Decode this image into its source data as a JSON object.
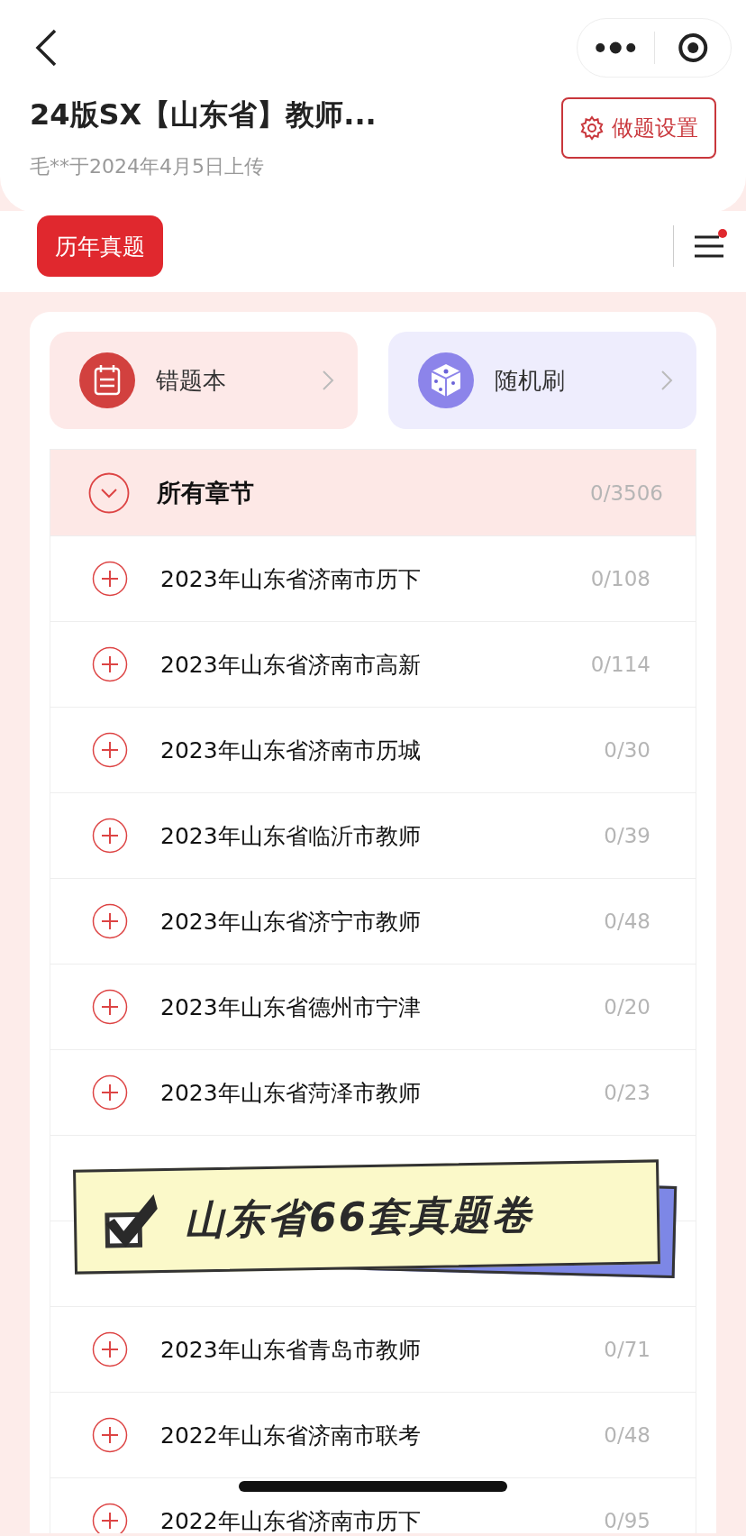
{
  "header": {
    "title": "24版SX【山东省】教师...",
    "subtitle": "毛**于2024年4月5日上传",
    "settings_button": "做题设置"
  },
  "tabs": [
    {
      "label": "历年真题",
      "selected": true
    }
  ],
  "filter": {
    "has_dot": true
  },
  "shortcuts": [
    {
      "kind": "notebook",
      "label": "错题本"
    },
    {
      "kind": "dice",
      "label": "随机刷"
    }
  ],
  "chapters": {
    "title": "所有章节",
    "count": "0/3506",
    "expanded": true,
    "rows": [
      {
        "kind": "row",
        "title": "2023年山东省济南市历下",
        "count": "0/108"
      },
      {
        "kind": "row",
        "title": "2023年山东省济南市高新",
        "count": "0/114"
      },
      {
        "kind": "row",
        "title": "2023年山东省济南市历城",
        "count": "0/30"
      },
      {
        "kind": "row",
        "title": "2023年山东省临沂市教师",
        "count": "0/39"
      },
      {
        "kind": "row",
        "title": "2023年山东省济宁市教师",
        "count": "0/48"
      },
      {
        "kind": "row",
        "title": "2023年山东省德州市宁津",
        "count": "0/20"
      },
      {
        "kind": "row",
        "title": "2023年山东省菏泽市教师",
        "count": "0/23"
      },
      {
        "kind": "covered"
      },
      {
        "kind": "covered"
      },
      {
        "kind": "row",
        "title": "2023年山东省青岛市教师",
        "count": "0/71"
      },
      {
        "kind": "row",
        "title": "2022年山东省济南市联考",
        "count": "0/48"
      },
      {
        "kind": "row",
        "title": "2022年山东省济南市历下",
        "count": "0/95"
      }
    ]
  },
  "banner": {
    "text": "山东省66套真题卷"
  }
}
